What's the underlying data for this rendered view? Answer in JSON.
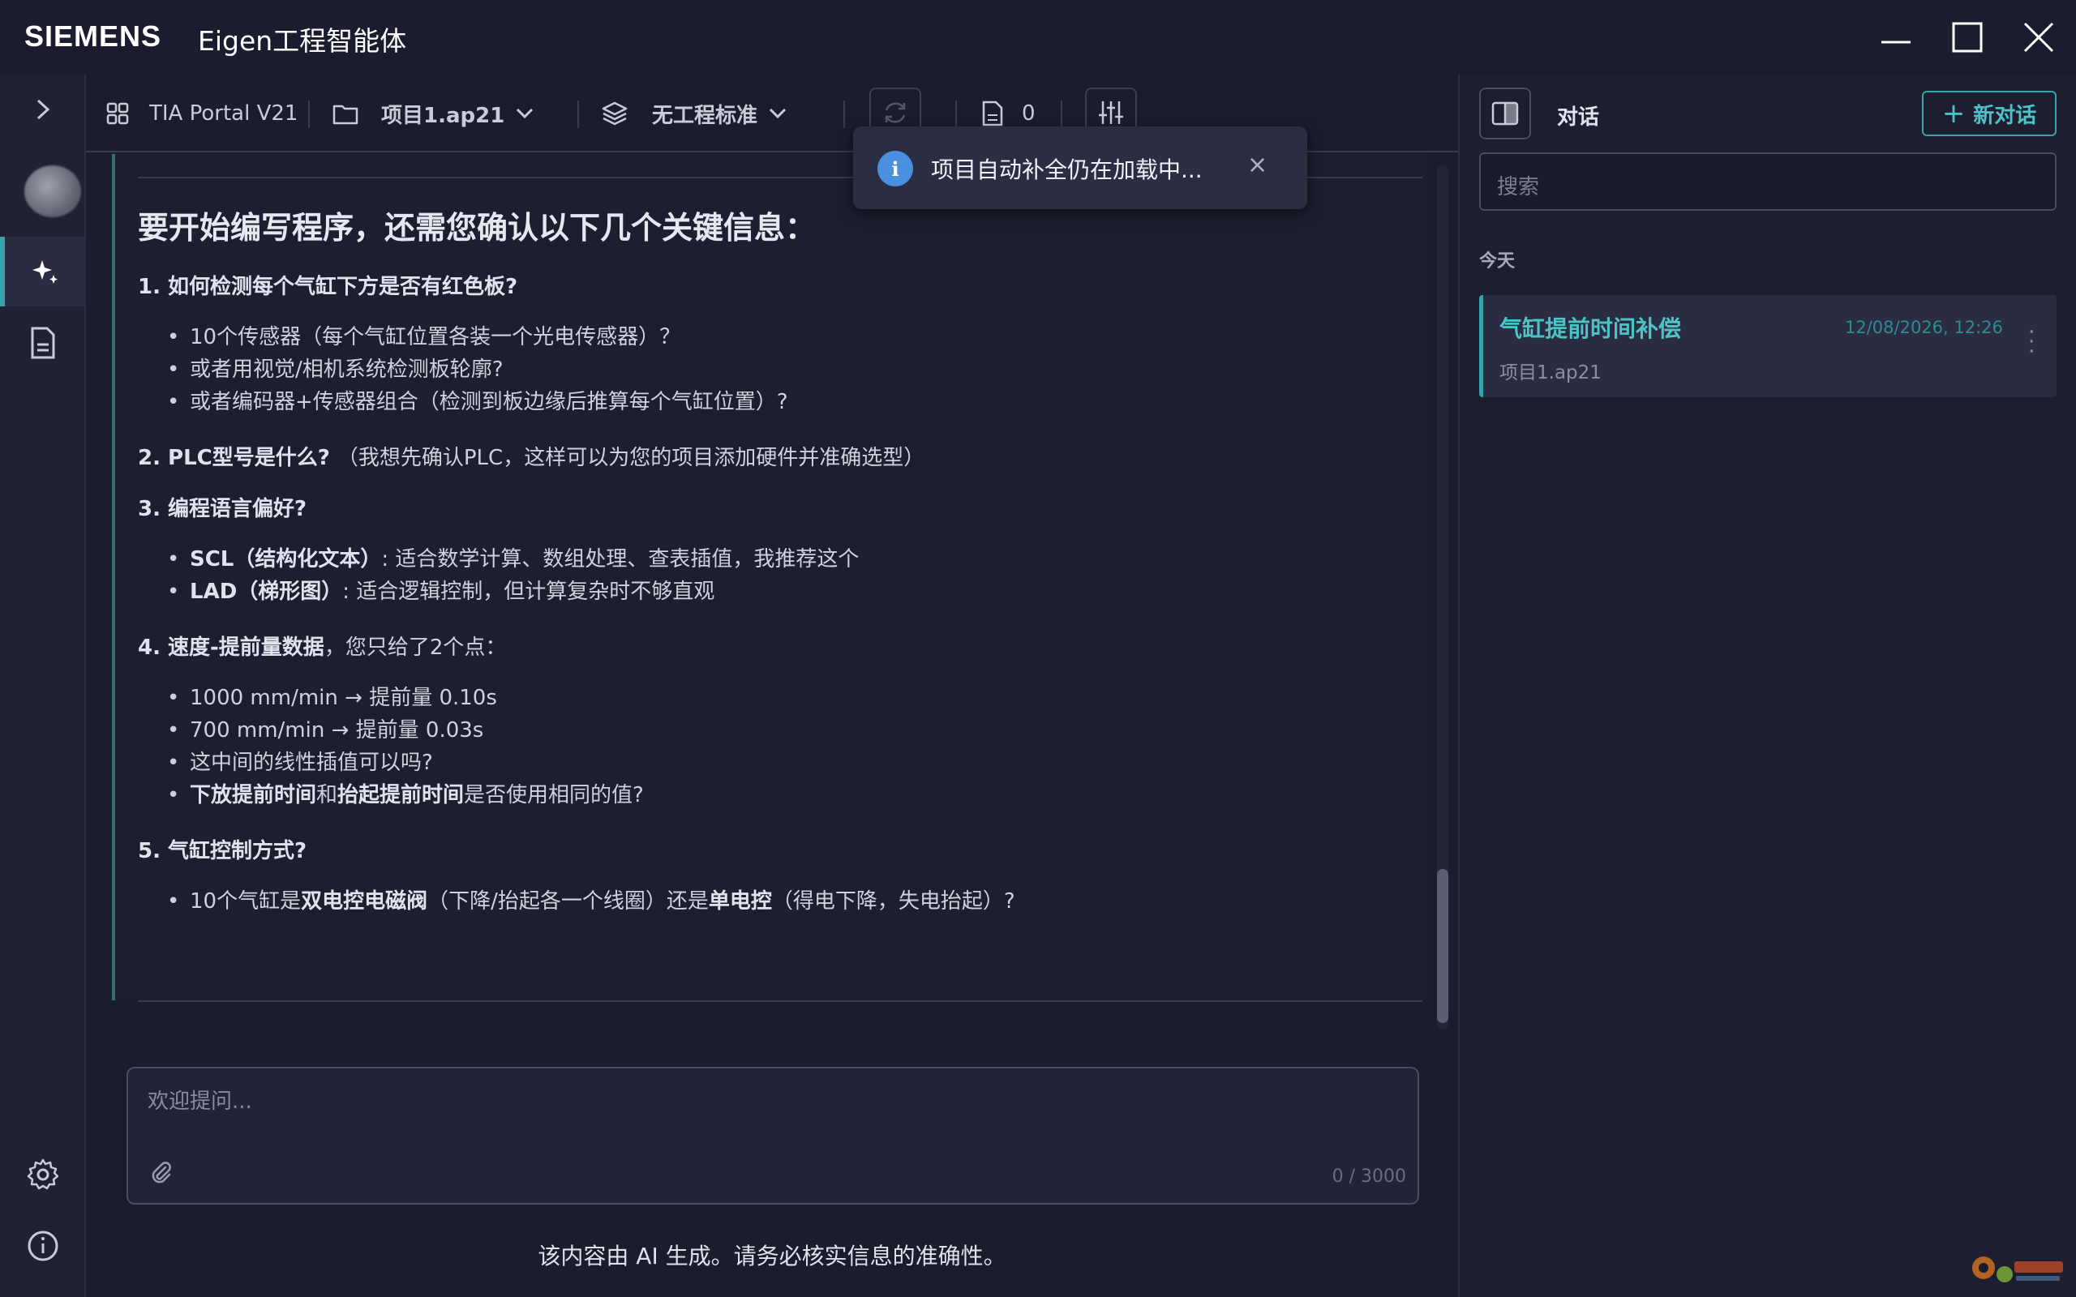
{
  "window": {
    "brand": "SIEMENS",
    "title": "Eigen工程智能体"
  },
  "toolbar": {
    "portal": "TIA Portal V21",
    "project": "项目1.ap21",
    "standard": "无工程标准",
    "doc_count": "0"
  },
  "toast": {
    "icon": "i",
    "text": "项目自动补全仍在加载中...",
    "close": "×"
  },
  "message": {
    "heading": "要开始编写程序，还需您确认以下几个关键信息：",
    "q1": "1. 如何检测每个气缸下方是否有红色板?",
    "q1_items": [
      "10个传感器（每个气缸位置各装一个光电传感器）？",
      "或者用视觉/相机系统检测板轮廓?",
      "或者编码器+传感器组合（检测到板边缘后推算每个气缸位置）?"
    ],
    "q2_bold": "2. PLC型号是什么?",
    "q2_rest": "（我想先确认PLC，这样可以为您的项目添加硬件并准确选型）",
    "q3": "3. 编程语言偏好?",
    "q3_items": [
      {
        "bold": "SCL（结构化文本）",
        "rest": ": 适合数学计算、数组处理、查表插值，我推荐这个"
      },
      {
        "bold": "LAD（梯形图）",
        "rest": ": 适合逻辑控制，但计算复杂时不够直观"
      }
    ],
    "q4_bold": "4. 速度-提前量数据",
    "q4_rest": "，您只给了2个点：",
    "q4_items": [
      "1000 mm/min → 提前量 0.10s",
      "700 mm/min → 提前量 0.03s",
      "这中间的线性插值可以吗?"
    ],
    "q4_last": {
      "b1": "下放提前时间",
      "m": "和",
      "b2": "抬起提前时间",
      "end": "是否使用相同的值?"
    },
    "q5": "5. 气缸控制方式?",
    "q5_item": {
      "a": "10个气缸是",
      "b1": "双电控电磁阀",
      "m": "（下降/抬起各一个线圈）还是",
      "b2": "单电控",
      "end": "（得电下降，失电抬起）?"
    }
  },
  "input": {
    "placeholder": "欢迎提问...",
    "counter": "0 / 3000"
  },
  "disclaimer": "该内容由 AI 生成。请务必核实信息的准确性。",
  "sidebar": {
    "title": "对话",
    "new_chat": "新对话",
    "search_placeholder": "搜索",
    "section_today": "今天",
    "conversations": [
      {
        "title": "气缸提前时间补偿",
        "date": "12/08/2026, 12:26",
        "subtitle": "项目1.ap21"
      }
    ]
  },
  "colors": {
    "accent": "#36a4a9",
    "background": "#1b1c2e",
    "info": "#4a8fe0"
  },
  "icons": [
    "chevron-right-icon",
    "avatar",
    "sparkle-icon",
    "document-icon",
    "gear-icon",
    "info-icon",
    "grid-icon",
    "folder-icon",
    "layers-icon",
    "refresh-icon",
    "file-icon",
    "sliders-icon",
    "panel-toggle-icon",
    "paperclip-icon",
    "minimize-icon",
    "maximize-icon",
    "close-icon"
  ]
}
